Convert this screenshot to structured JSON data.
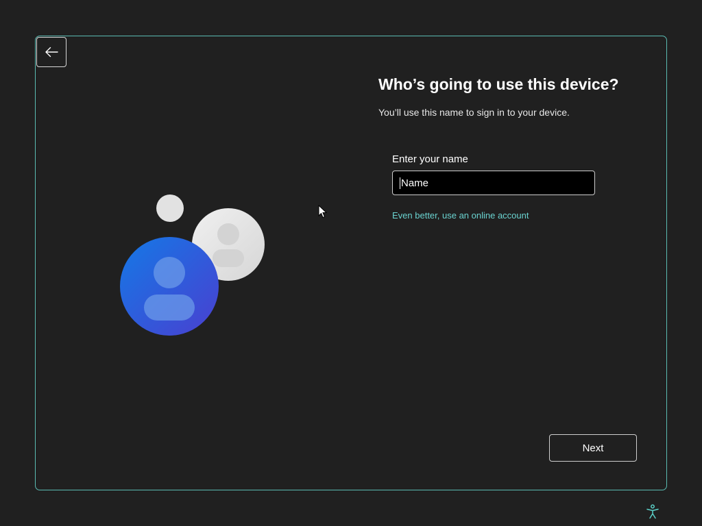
{
  "page": {
    "heading": "Who’s going to use this device?",
    "subheading": "You’ll use this name to sign in to your device."
  },
  "form": {
    "label": "Enter your name",
    "input_value": "Name",
    "online_account_link": "Even better, use an online account"
  },
  "footer": {
    "next_label": "Next"
  },
  "icons": {
    "back": "arrow-left-icon",
    "accessibility": "accessibility-icon",
    "illustration": "user-accounts-illustration"
  },
  "colors": {
    "background": "#202020",
    "panel_border": "#5bbdb4",
    "link": "#6ad3d0",
    "accent_blue": "#1f6fe0",
    "avatar_grey": "#e4e4e4"
  }
}
